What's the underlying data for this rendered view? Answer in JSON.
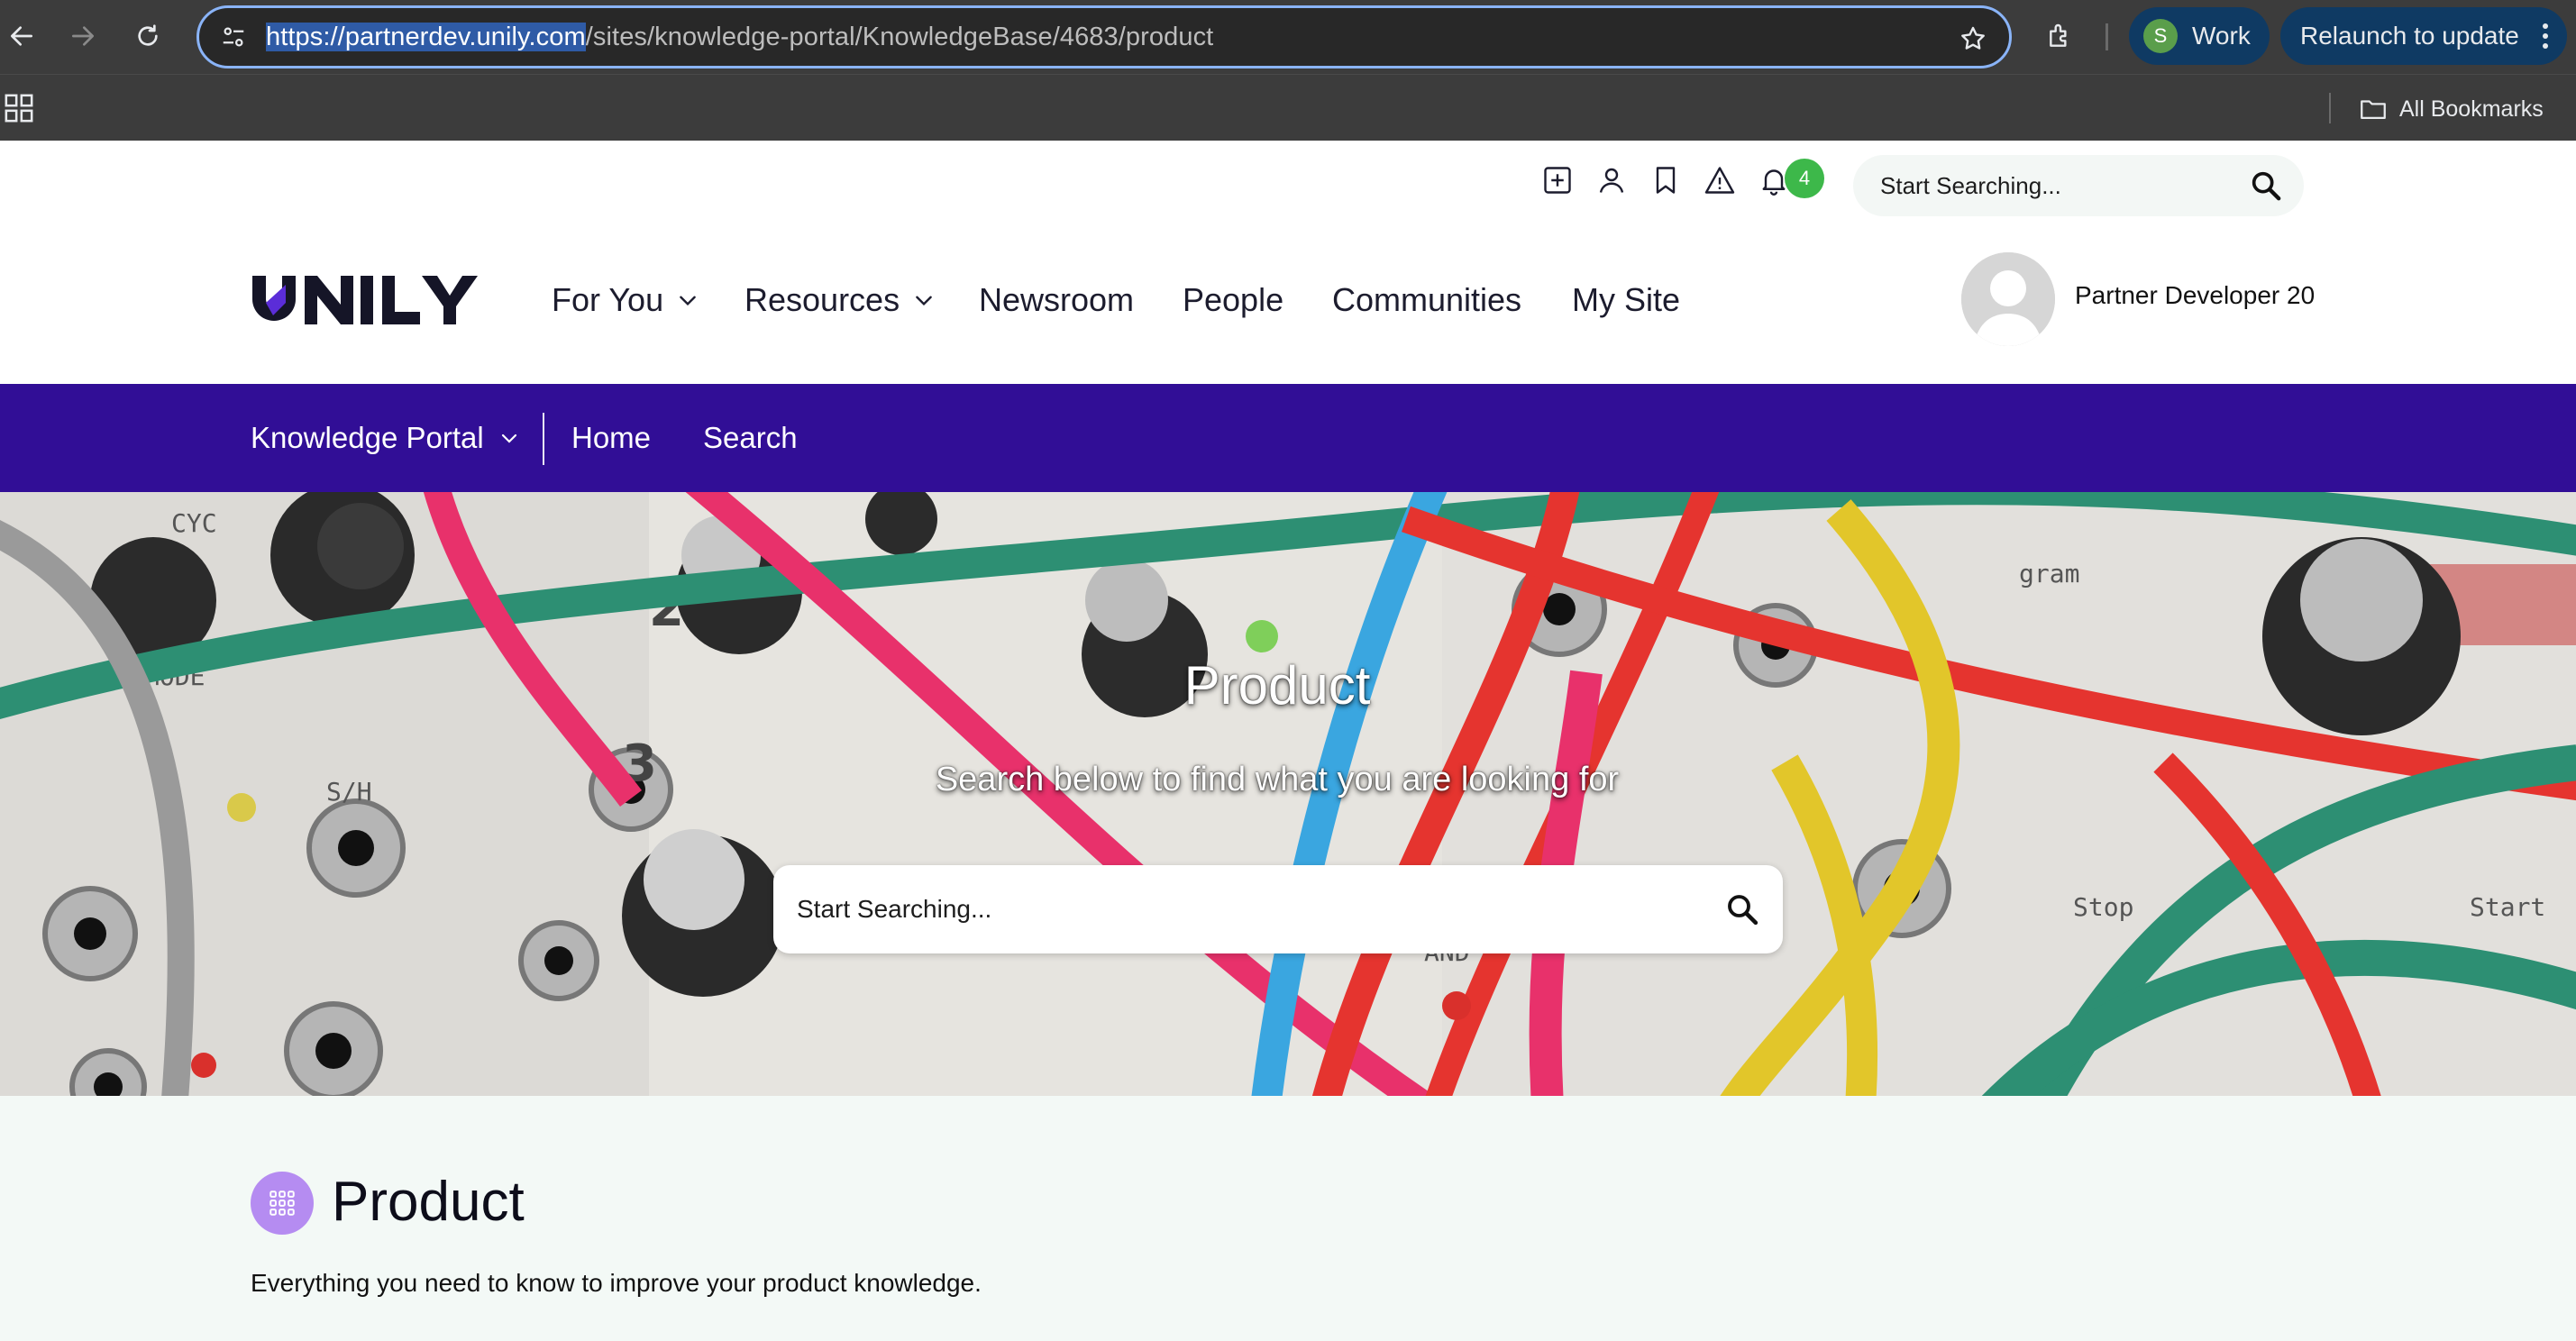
{
  "browser": {
    "url_host": "https://partnerdev.unily.com",
    "url_path": "/sites/knowledge-portal/KnowledgeBase/4683/product",
    "profile_initial": "S",
    "profile_label": "Work",
    "relaunch_label": "Relaunch to update",
    "all_bookmarks_label": "All Bookmarks"
  },
  "header": {
    "notification_count": "4",
    "search_placeholder": "Start Searching...",
    "nav": [
      {
        "label": "For You",
        "has_dropdown": true
      },
      {
        "label": "Resources",
        "has_dropdown": true
      },
      {
        "label": "Newsroom",
        "has_dropdown": false
      },
      {
        "label": "People",
        "has_dropdown": false
      },
      {
        "label": "Communities",
        "has_dropdown": false
      },
      {
        "label": "My Site",
        "has_dropdown": false
      }
    ],
    "user_name": "Partner Developer 20"
  },
  "sitebar": {
    "site_label": "Knowledge Portal",
    "items": [
      {
        "label": "Home"
      },
      {
        "label": "Search"
      }
    ]
  },
  "hero": {
    "title": "Product",
    "subtitle": "Search below to find what you are looking for",
    "search_placeholder": "Start Searching..."
  },
  "content": {
    "title": "Product",
    "description": "Everything you need to know to improve your product knowledge."
  },
  "colors": {
    "brand_purple": "#310e96",
    "page_icon": "#b58cf1",
    "notification_green": "#3db84a",
    "omnibox_focus": "#8ab4f8"
  }
}
